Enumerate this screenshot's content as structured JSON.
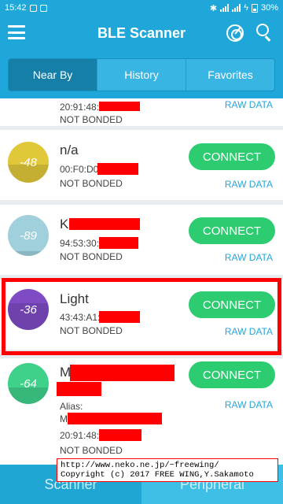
{
  "status_bar": {
    "time": "15:42",
    "battery": "30%"
  },
  "app_bar": {
    "title": "BLE Scanner"
  },
  "tabs": [
    {
      "label": "Near By"
    },
    {
      "label": "History"
    },
    {
      "label": "Favorites"
    }
  ],
  "devices": [
    {
      "name": "",
      "rssi": "",
      "address": "20:91:48:",
      "status": "NOT BONDED",
      "connect_label": "",
      "raw_label": "RAW DATA"
    },
    {
      "name": "n/a",
      "rssi": "-48",
      "address": "00:F0:D0",
      "status": "NOT BONDED",
      "connect_label": "CONNECT",
      "raw_label": "RAW DATA",
      "color": "#e1c83a",
      "fill_level": 0.45
    },
    {
      "name": "K",
      "rssi": "-89",
      "address": "94:53:30:",
      "status": "NOT BONDED",
      "connect_label": "CONNECT",
      "raw_label": "RAW DATA",
      "color": "#9fd0dc",
      "fill_level": 0.12
    },
    {
      "name": "Light",
      "rssi": "-36",
      "address": "43:43:A1:",
      "status": "NOT BONDED",
      "connect_label": "CONNECT",
      "raw_label": "RAW DATA",
      "color": "#7e4bc4",
      "fill_level": 0.65
    },
    {
      "name": "M",
      "rssi": "-64",
      "alias_label": "Alias:",
      "alias_value": "M",
      "address": "20:91:48:",
      "status": "NOT BONDED",
      "connect_label": "CONNECT",
      "raw_label": "RAW DATA",
      "color": "#3fd18a",
      "fill_level": 0.4
    }
  ],
  "bottom_nav": [
    {
      "label": "Scanner"
    },
    {
      "label": "Peripheral"
    }
  ],
  "credit": {
    "line1": "http://www.neko.ne.jp/~freewing/",
    "line2": "Copyright (c) 2017 FREE WING,Y.Sakamoto"
  },
  "colors": {
    "primary": "#20a7d9",
    "connect": "#2ecc71",
    "link": "#25a6d9",
    "redact": "#ff0000"
  }
}
